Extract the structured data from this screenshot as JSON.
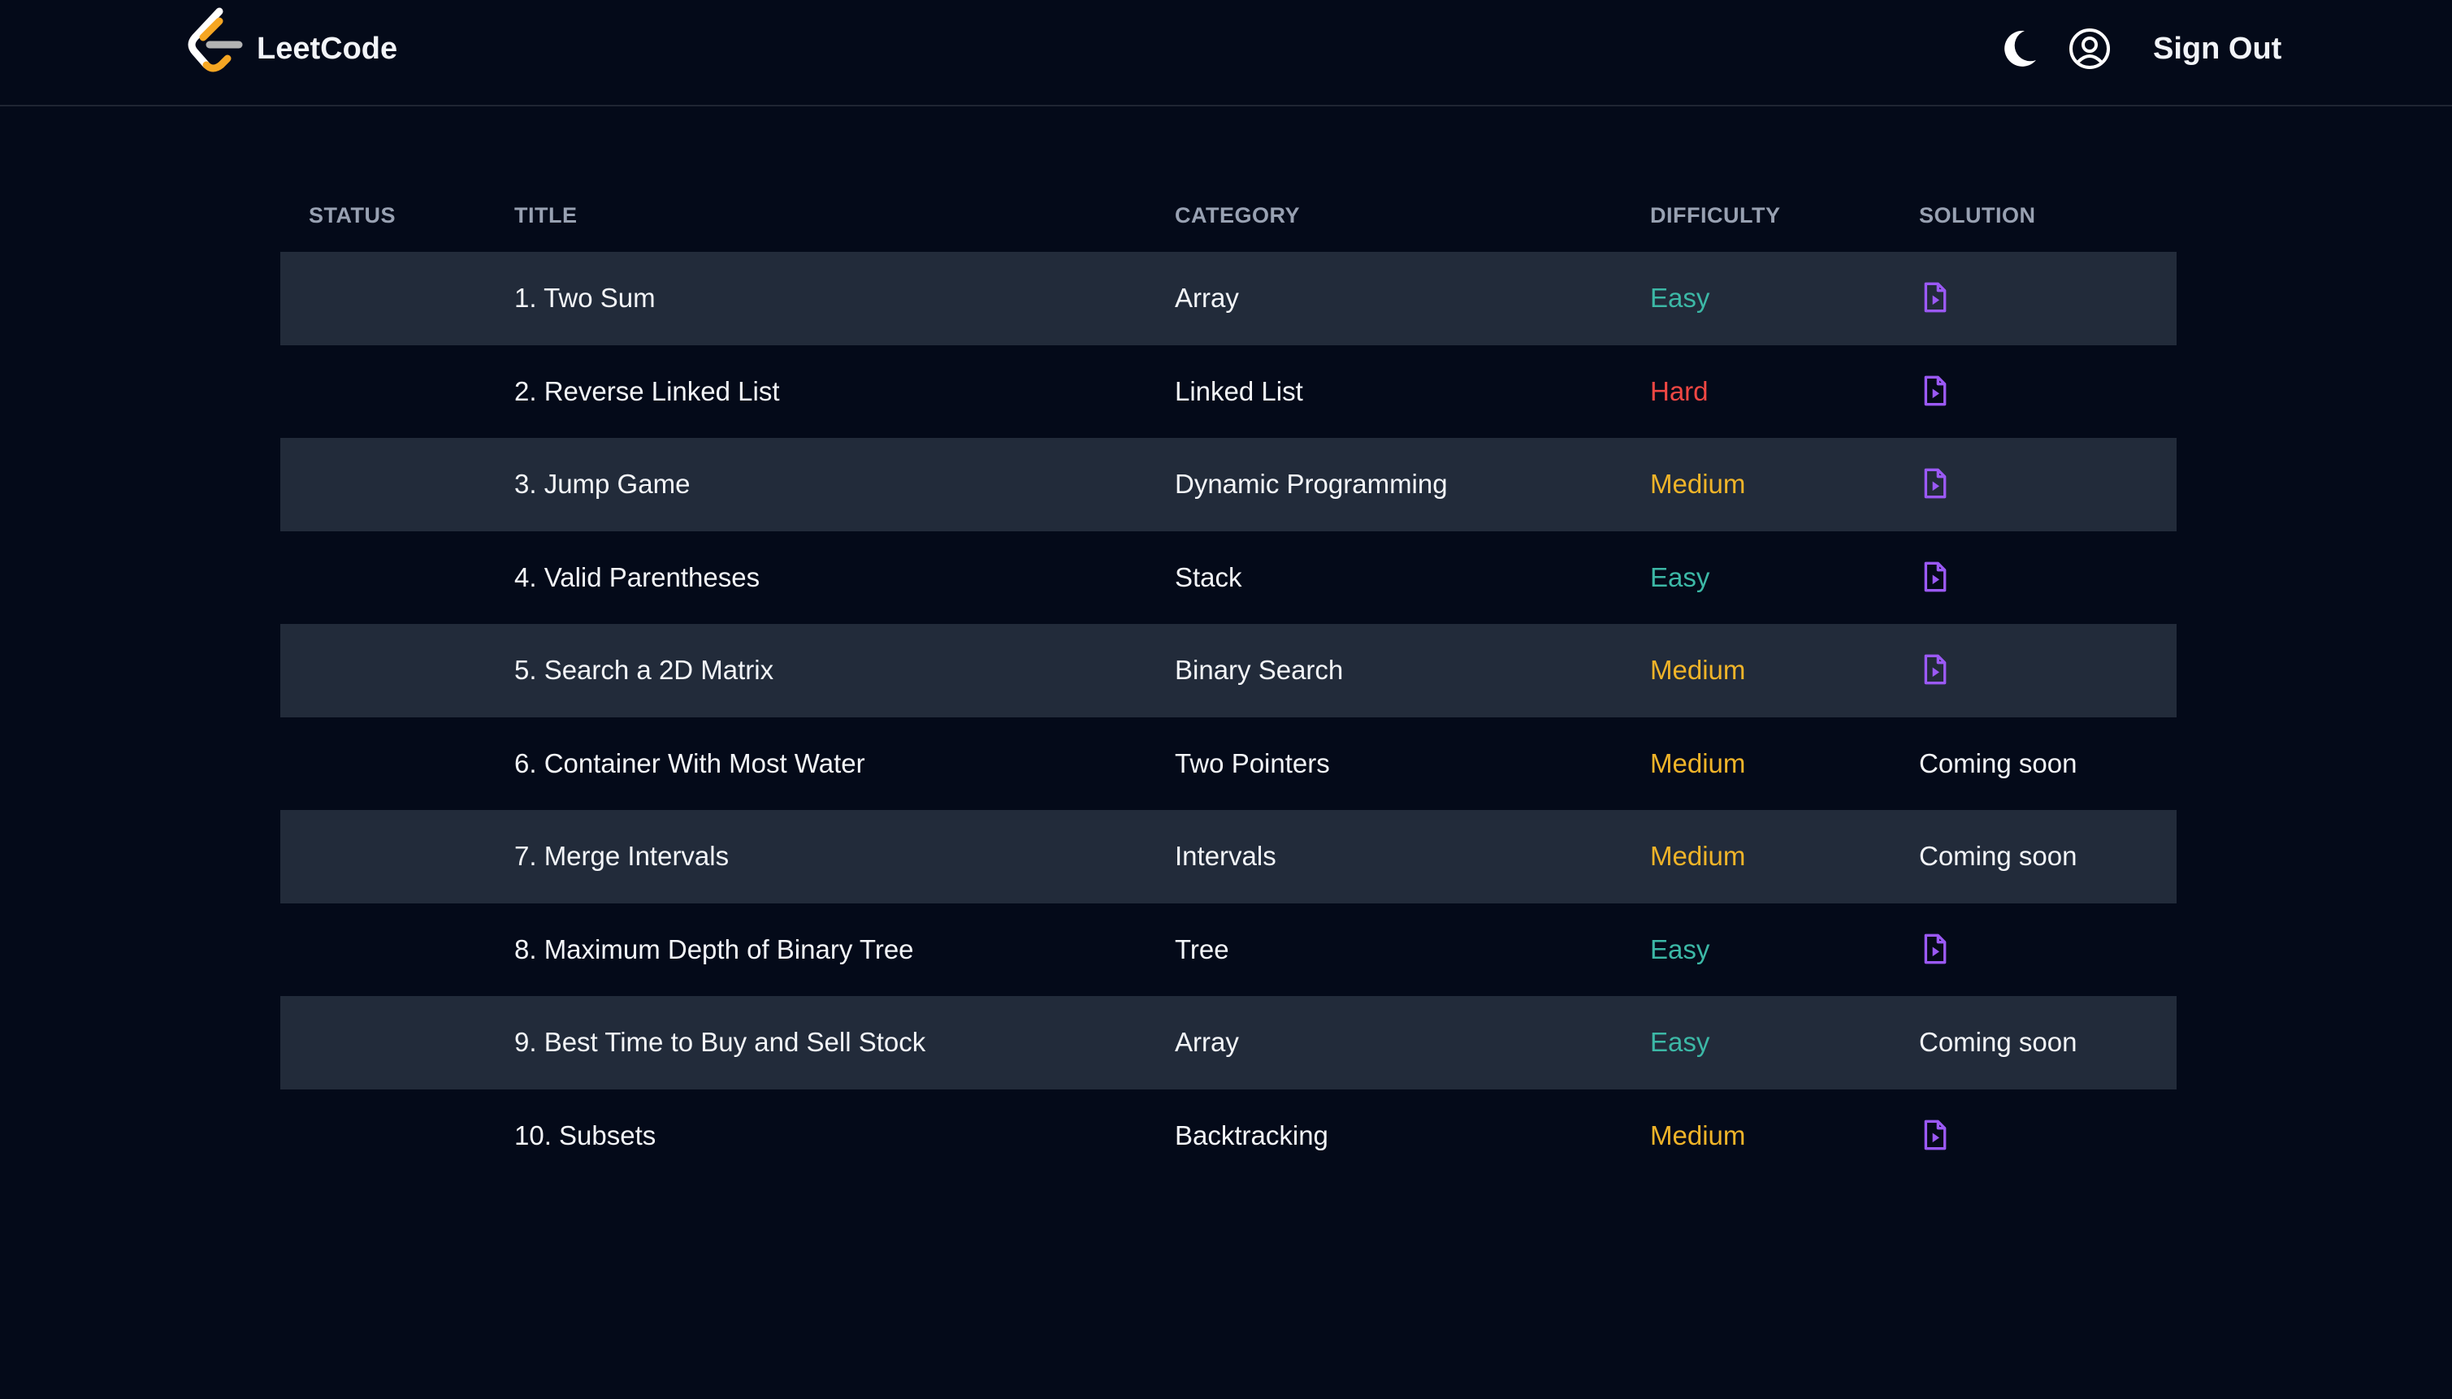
{
  "header": {
    "brand": "LeetCode",
    "sign_out_label": "Sign Out",
    "icons": [
      "leetcode-logo",
      "moon-icon",
      "user-circle-icon"
    ]
  },
  "table": {
    "columns": [
      "STATUS",
      "TITLE",
      "CATEGORY",
      "DIFFICULTY",
      "SOLUTION"
    ],
    "rows": [
      {
        "status": "",
        "title": "1. Two Sum",
        "category": "Array",
        "difficulty": "Easy",
        "solution": "video"
      },
      {
        "status": "",
        "title": "2. Reverse Linked List",
        "category": "Linked List",
        "difficulty": "Hard",
        "solution": "video"
      },
      {
        "status": "",
        "title": "3. Jump Game",
        "category": "Dynamic Programming",
        "difficulty": "Medium",
        "solution": "video"
      },
      {
        "status": "",
        "title": "4. Valid Parentheses",
        "category": "Stack",
        "difficulty": "Easy",
        "solution": "video"
      },
      {
        "status": "",
        "title": "5. Search a 2D Matrix",
        "category": "Binary Search",
        "difficulty": "Medium",
        "solution": "video"
      },
      {
        "status": "",
        "title": "6. Container With Most Water",
        "category": "Two Pointers",
        "difficulty": "Medium",
        "solution": "Coming soon"
      },
      {
        "status": "",
        "title": "7. Merge Intervals",
        "category": "Intervals",
        "difficulty": "Medium",
        "solution": "Coming soon"
      },
      {
        "status": "",
        "title": "8. Maximum Depth of Binary Tree",
        "category": "Tree",
        "difficulty": "Easy",
        "solution": "video"
      },
      {
        "status": "",
        "title": "9. Best Time to Buy and Sell Stock",
        "category": "Array",
        "difficulty": "Easy",
        "solution": "Coming soon"
      },
      {
        "status": "",
        "title": "10. Subsets",
        "category": "Backtracking",
        "difficulty": "Medium",
        "solution": "video"
      }
    ]
  },
  "colors": {
    "background": "#040a19",
    "stripe": "#222b3a",
    "easy": "#3cb8a6",
    "medium": "#f0b429",
    "hard": "#ef4743",
    "solution_icon": "#9b59f5",
    "logo_orange": "#f5a623"
  }
}
